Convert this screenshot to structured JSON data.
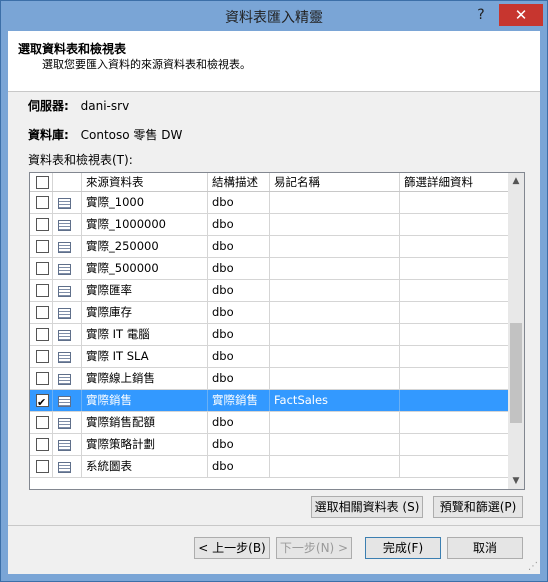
{
  "window": {
    "title": "資料表匯入精靈",
    "help": "?",
    "close": "✕"
  },
  "header": {
    "title": "選取資料表和檢視表",
    "subtitle": "選取您要匯入資料的來源資料表和檢視表。"
  },
  "server": {
    "label": "伺服器:",
    "value": "dani-srv"
  },
  "database": {
    "label": "資料庫:",
    "value": "Contoso 零售 DW"
  },
  "tables_label": "資料表和檢視表(T):",
  "columns": [
    "來源資料表",
    "結構描述",
    "易記名稱",
    "篩選詳細資料"
  ],
  "rows": [
    {
      "name": "實際_1000",
      "schema": "dbo",
      "friendly": "",
      "checked": false,
      "selected": false
    },
    {
      "name": "實際_1000000",
      "schema": "dbo",
      "friendly": "",
      "checked": false,
      "selected": false
    },
    {
      "name": "實際_250000",
      "schema": "dbo",
      "friendly": "",
      "checked": false,
      "selected": false
    },
    {
      "name": "實際_500000",
      "schema": "dbo",
      "friendly": "",
      "checked": false,
      "selected": false
    },
    {
      "name": "實際匯率",
      "schema": "dbo",
      "friendly": "",
      "checked": false,
      "selected": false
    },
    {
      "name": "實際庫存",
      "schema": "dbo",
      "friendly": "",
      "checked": false,
      "selected": false
    },
    {
      "name": "實際 IT 電腦",
      "schema": "dbo",
      "friendly": "",
      "checked": false,
      "selected": false
    },
    {
      "name": "實際 IT SLA",
      "schema": "dbo",
      "friendly": "",
      "checked": false,
      "selected": false
    },
    {
      "name": "實際線上銷售",
      "schema": "dbo",
      "friendly": "",
      "checked": false,
      "selected": false
    },
    {
      "name": "實際銷售",
      "schema": "實際銷售",
      "friendly": "FactSales",
      "checked": true,
      "selected": true
    },
    {
      "name": "實際銷售配額",
      "schema": "dbo",
      "friendly": "",
      "checked": false,
      "selected": false
    },
    {
      "name": "實際策略計劃",
      "schema": "dbo",
      "friendly": "",
      "checked": false,
      "selected": false
    },
    {
      "name": "系統圖表",
      "schema": "dbo",
      "friendly": "",
      "checked": false,
      "selected": false
    }
  ],
  "buttons": {
    "select_related": "選取相關資料表 (S)",
    "preview": "預覽和篩選(P)",
    "back": "< 上一步(B)",
    "next": "下一步(N) >",
    "finish": "完成(F)",
    "cancel": "取消"
  }
}
